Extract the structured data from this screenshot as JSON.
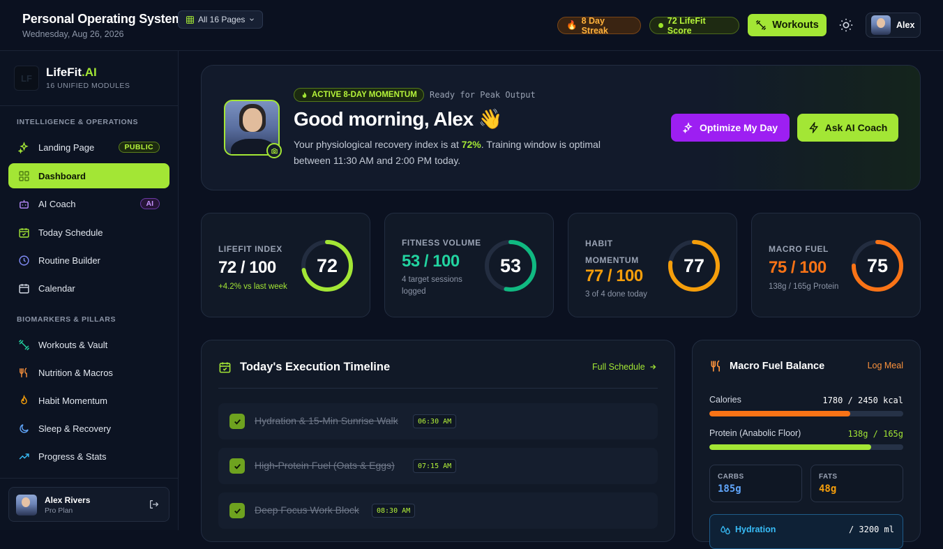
{
  "header": {
    "title": "Personal Operating System",
    "date": "Wednesday, Aug 26, 2026",
    "pages_button": "All 16 Pages",
    "streak": "8 Day Streak",
    "score": "72 LifeFit Score",
    "workouts_button": "Workouts",
    "user_name": "Alex"
  },
  "sidebar": {
    "brand_main": "LifeFit",
    "brand_accent": ".AI",
    "brand_logo": "LF",
    "brand_sub": "16 UNIFIED MODULES",
    "section1": "INTELLIGENCE & OPERATIONS",
    "section2": "BIOMARKERS & PILLARS",
    "items": [
      {
        "label": "Landing Page",
        "badge": "PUBLIC",
        "icon": "sparkles-icon"
      },
      {
        "label": "Dashboard",
        "icon": "grid-icon"
      },
      {
        "label": "AI Coach",
        "badge": "AI",
        "icon": "bot-icon"
      },
      {
        "label": "Today Schedule",
        "icon": "calendar-check-icon"
      },
      {
        "label": "Routine Builder",
        "icon": "clock-icon"
      },
      {
        "label": "Calendar",
        "icon": "calendar-icon"
      },
      {
        "label": "Workouts & Vault",
        "icon": "dumbbell-icon"
      },
      {
        "label": "Nutrition & Macros",
        "icon": "utensils-icon"
      },
      {
        "label": "Habit Momentum",
        "icon": "flame-icon"
      },
      {
        "label": "Sleep & Recovery",
        "icon": "moon-icon"
      },
      {
        "label": "Progress & Stats",
        "icon": "trending-up-icon"
      }
    ],
    "profile": {
      "name": "Alex Rivers",
      "plan": "Pro Plan"
    }
  },
  "hero": {
    "momentum": "ACTIVE 8-DAY MOMENTUM",
    "ready": "Ready for Peak Output",
    "greeting": "Good morning, Alex",
    "emoji": "👋",
    "msg_pre": "Your physiological recovery index is at ",
    "msg_pct": "72%",
    "msg_post": ". Training window is optimal between 11:30 AM and 2:00 PM today.",
    "btn_optimize": "Optimize My Day",
    "btn_coach": "Ask AI Coach"
  },
  "stats": [
    {
      "label": "LIFEFIT INDEX",
      "value": "72 / 100",
      "sub": "+4.2% vs last week",
      "ring": "72",
      "pct": 72,
      "color": "#a3e635",
      "valueColor": "#ffffff",
      "subColor": "#a3e635"
    },
    {
      "label": "FITNESS VOLUME",
      "value": "53 / 100",
      "sub": "4 target sessions logged",
      "ring": "53",
      "pct": 53,
      "color": "#10b981",
      "valueColor": "#22d3a0",
      "subColor": "#8c95a7"
    },
    {
      "label": "HABIT MOMENTUM",
      "value": "77 / 100",
      "sub": "3 of 4 done today",
      "ring": "77",
      "pct": 77,
      "color": "#f59e0b",
      "valueColor": "#f59e0b",
      "subColor": "#8c95a7"
    },
    {
      "label": "MACRO FUEL",
      "value": "75 / 100",
      "sub": "138g / 165g Protein",
      "ring": "75",
      "pct": 75,
      "color": "#f97316",
      "valueColor": "#f97316",
      "subColor": "#8c95a7"
    }
  ],
  "timeline": {
    "title": "Today's Execution Timeline",
    "link": "Full Schedule",
    "tasks": [
      {
        "text": "Hydration & 15-Min Sunrise Walk",
        "time": "06:30 AM"
      },
      {
        "text": "High-Protein Fuel (Oats & Eggs)",
        "time": "07:15 AM"
      },
      {
        "text": "Deep Focus Work Block",
        "time": "08:30 AM"
      }
    ]
  },
  "macro": {
    "title": "Macro Fuel Balance",
    "link": "Log Meal",
    "calories_label": "Calories",
    "calories_val": "1780 / 2450 kcal",
    "calories_pct": 72.7,
    "protein_label": "Protein (Anabolic Floor)",
    "protein_val": "138g / 165g",
    "protein_pct": 83.6,
    "carbs_label": "CARBS",
    "carbs_val": "185g",
    "fats_label": "FATS",
    "fats_val": "48g",
    "hydration_label": "Hydration",
    "hydration_val": "/ 3200 ml"
  },
  "colors": {
    "accent": "#a3e635",
    "purple": "#9d1ff2",
    "orange": "#f97316",
    "amber": "#f59e0b",
    "teal": "#10b981",
    "blue": "#38bdf8"
  }
}
